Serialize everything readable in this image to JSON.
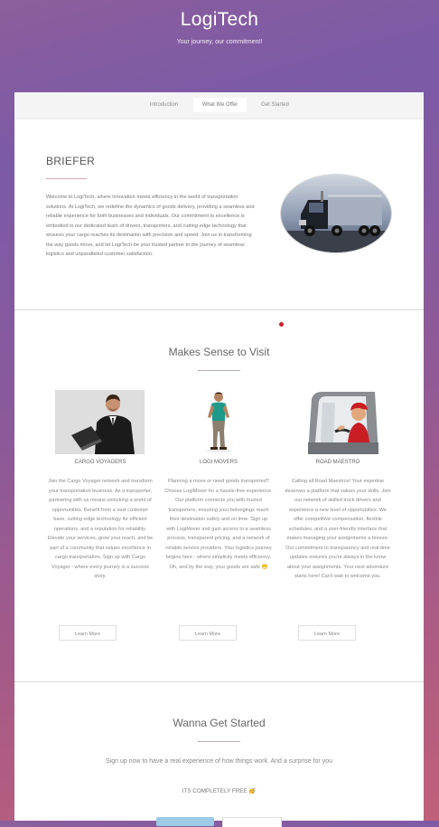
{
  "header": {
    "title": "LogiTech",
    "tagline": "Your journey, our commitment!"
  },
  "nav": {
    "tabs": [
      {
        "label": "Introduction",
        "active": false
      },
      {
        "label": "What We Offer",
        "active": true
      },
      {
        "label": "Get Started",
        "active": false
      }
    ]
  },
  "briefer": {
    "title": "BRIEFER",
    "text": "Welcome to LogiTech, where innovation meets efficiency in the world of transportation solutions. At LogiTech, we redefine the dynamics of goods delivery, providing a seamless and reliable experience for both businesses and individuals. Our commitment to excellence is embodied in our dedicated team of drivers, transporters, and cutting-edge technology that ensures your cargo reaches its destination with precision and speed. Join us in transforming the way goods move, and let LogiTech be your trusted partner in the journey of seamless logistics and unparalleled customer satisfaction."
  },
  "offer": {
    "title": "Makes Sense to Visit",
    "cards": [
      {
        "title": "CARGO VOYAGERS",
        "text": "Join the Cargo Voyager network and transform your transportation business. As a transporter, partnering with us means unlocking a world of opportunities. Benefit from a vast customer base, cutting-edge technology for efficient operations, and a reputation for reliability. Elevate your services, grow your reach, and be part of a community that values excellence in cargo transportation. Sign up with Cargo Voyager - where every journey is a success story.",
        "button": "Learn More"
      },
      {
        "title": "LOGI MOVERS",
        "text": "Planning a move or need goods transported? Choose LogiMover for a hassle-free experience. Our platform connects you with trusted transporters, ensuring your belongings reach their destination safely and on time. Sign up with LogiMover and gain access to a seamless process, transparent pricing, and a network of reliable service providers. Your logistics journey begins here - where simplicity meets efficiency. Oh, and by the way, your goods are safe 😁",
        "button": "Learn More"
      },
      {
        "title": "ROAD MAESTRO",
        "text": "Calling all Road Maestros! Your expertise deserves a platform that values your skills. Join our network of skilled truck drivers and experience a new level of opportunities. We offer competitive compensation, flexible schedules, and a user-friendly interface that makes managing your assignments a breeze. Our commitment to transparency and real-time updates ensures you're always in the know about your assignments. Your next adventure starts here! Can't wait to welcome you.",
        "button": "Learn More"
      }
    ]
  },
  "start": {
    "title": "Wanna Get Started",
    "subtitle": "Sign up now to have a real experience of how things work. And a surprise for you",
    "free_text": "ITS COMPLETELY FREE 🥳"
  },
  "colors": {
    "gradient_top": "#7b5aa6",
    "gradient_bottom": "#c06079",
    "accent_dot": "#cf1f2d",
    "primary_button": "#9ccbe5"
  }
}
